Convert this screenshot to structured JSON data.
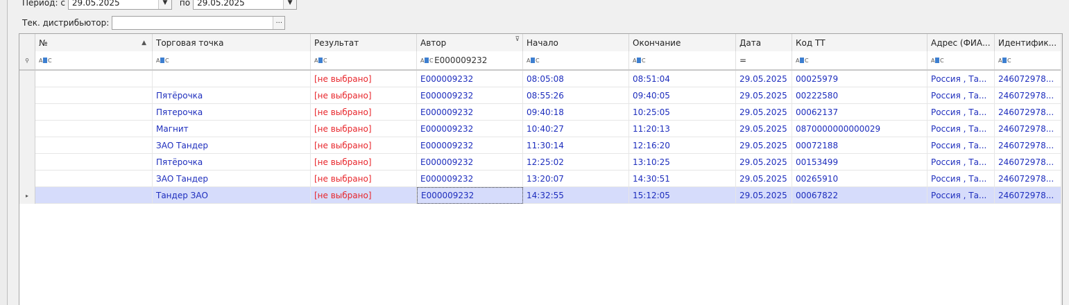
{
  "filters": {
    "period_from_label": "Период: с",
    "period_from_value": "29.05.2025",
    "period_to_label": "по",
    "period_to_value": "29.05.2025",
    "distributor_label": "Тек. дистрибьютор:",
    "distributor_value": ""
  },
  "grid": {
    "columns": [
      "№",
      "Торговая точка",
      "Результат",
      "Автор",
      "Начало",
      "Окончание",
      "Дата",
      "Код ТТ",
      "Адрес (ФИА...",
      "Идентифик..."
    ],
    "filter_author": "E000009232",
    "filter_date_icon": "=",
    "rows": [
      {
        "no": "",
        "point": "",
        "result": "[не выбрано]",
        "author": "E000009232",
        "start": "08:05:08",
        "end": "08:51:04",
        "date": "29.05.2025",
        "code": "00025979",
        "address": "Россия , Та...",
        "ident": "246072978..."
      },
      {
        "no": "",
        "point": "Пятёрочка",
        "result": "[не выбрано]",
        "author": "E000009232",
        "start": "08:55:26",
        "end": "09:40:05",
        "date": "29.05.2025",
        "code": "00222580",
        "address": "Россия , Та...",
        "ident": "246072978..."
      },
      {
        "no": "",
        "point": "Пятерочка",
        "result": "[не выбрано]",
        "author": "E000009232",
        "start": "09:40:18",
        "end": "10:25:05",
        "date": "29.05.2025",
        "code": "00062137",
        "address": "Россия , Та...",
        "ident": "246072978..."
      },
      {
        "no": "",
        "point": "Магнит",
        "result": "[не выбрано]",
        "author": "E000009232",
        "start": "10:40:27",
        "end": "11:20:13",
        "date": "29.05.2025",
        "code": "0870000000000029",
        "address": "Россия , Та...",
        "ident": "246072978..."
      },
      {
        "no": "",
        "point": "ЗАО Тандер",
        "result": "[не выбрано]",
        "author": "E000009232",
        "start": "11:30:14",
        "end": "12:16:20",
        "date": "29.05.2025",
        "code": "00072188",
        "address": "Россия , Та...",
        "ident": "246072978..."
      },
      {
        "no": "",
        "point": "Пятёрочка",
        "result": "[не выбрано]",
        "author": "E000009232",
        "start": "12:25:02",
        "end": "13:10:25",
        "date": "29.05.2025",
        "code": "00153499",
        "address": "Россия , Та...",
        "ident": "246072978..."
      },
      {
        "no": "",
        "point": "ЗАО Тандер",
        "result": "[не выбрано]",
        "author": "E000009232",
        "start": "13:20:07",
        "end": "14:30:51",
        "date": "29.05.2025",
        "code": "00265910",
        "address": "Россия , Та...",
        "ident": "246072978..."
      },
      {
        "no": "",
        "point": "Тандер ЗАО",
        "result": "[не выбрано]",
        "author": "E000009232",
        "start": "14:32:55",
        "end": "15:12:05",
        "date": "29.05.2025",
        "code": "00067822",
        "address": "Россия , Та...",
        "ident": "246072978..."
      }
    ]
  },
  "colors": {
    "link_text": "#1d2dbd",
    "result_text": "#e8252b",
    "selected_row": "#d6dcfb"
  }
}
